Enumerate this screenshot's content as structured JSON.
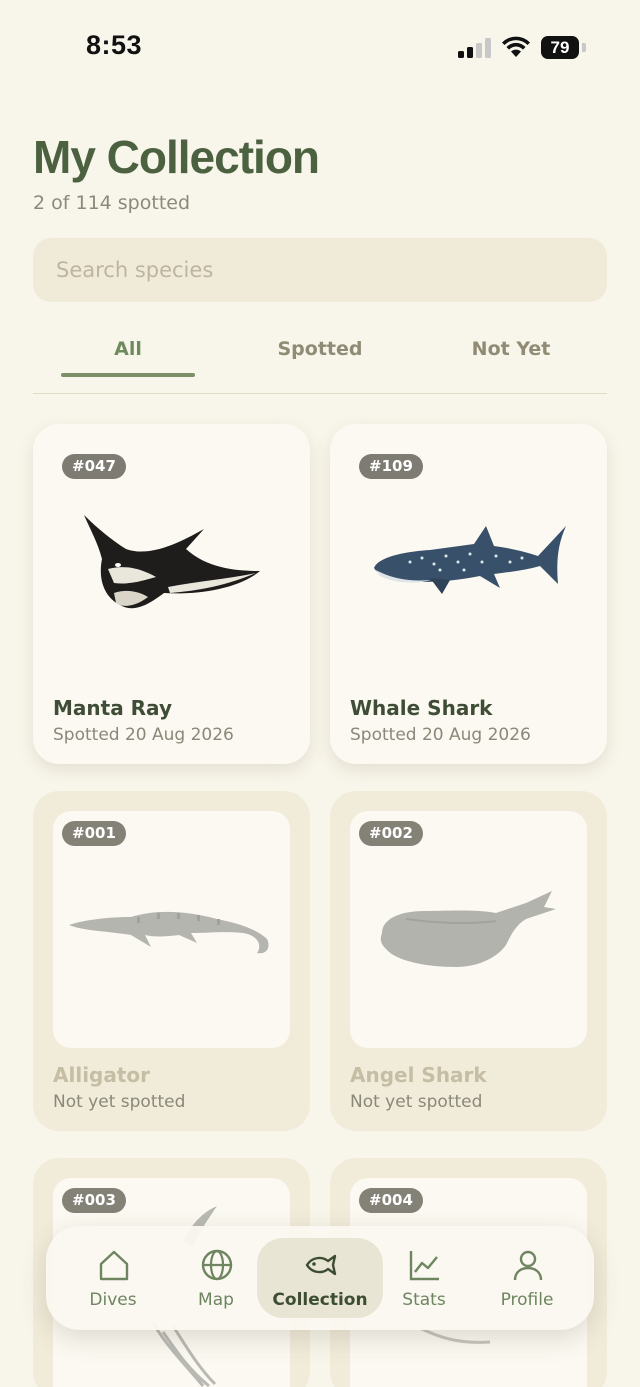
{
  "status_bar": {
    "time": "8:53",
    "battery": "79"
  },
  "header": {
    "title": "My Collection",
    "subtitle": "2 of 114 spotted"
  },
  "search": {
    "placeholder": "Search species",
    "value": ""
  },
  "tabs": [
    {
      "label": "All",
      "active": true
    },
    {
      "label": "Spotted",
      "active": false
    },
    {
      "label": "Not Yet",
      "active": false
    }
  ],
  "cards": [
    {
      "number": "#047",
      "name": "Manta Ray",
      "status": "Spotted 20 Aug 2026",
      "spotted": true,
      "icon": "manta-ray-illustration"
    },
    {
      "number": "#109",
      "name": "Whale Shark",
      "status": "Spotted 20 Aug 2026",
      "spotted": true,
      "icon": "whale-shark-illustration"
    },
    {
      "number": "#001",
      "name": "Alligator",
      "status": "Not yet spotted",
      "spotted": false,
      "icon": "alligator-silhouette"
    },
    {
      "number": "#002",
      "name": "Angel Shark",
      "status": "Not yet spotted",
      "spotted": false,
      "icon": "angel-shark-silhouette"
    },
    {
      "number": "#003",
      "name": "",
      "status": "",
      "spotted": false,
      "icon": "fish-silhouette"
    },
    {
      "number": "#004",
      "name": "",
      "status": "",
      "spotted": false,
      "icon": "fish-silhouette"
    }
  ],
  "nav": [
    {
      "label": "Dives",
      "icon": "home-icon",
      "active": false
    },
    {
      "label": "Map",
      "icon": "globe-icon",
      "active": false
    },
    {
      "label": "Collection",
      "icon": "fish-icon",
      "active": true
    },
    {
      "label": "Stats",
      "icon": "chart-icon",
      "active": false
    },
    {
      "label": "Profile",
      "icon": "person-icon",
      "active": false
    }
  ],
  "colors": {
    "background": "#f8f5ea",
    "accent_green": "#4b6140",
    "tab_active": "#6f8a5f",
    "badge": "#7d7b72"
  }
}
